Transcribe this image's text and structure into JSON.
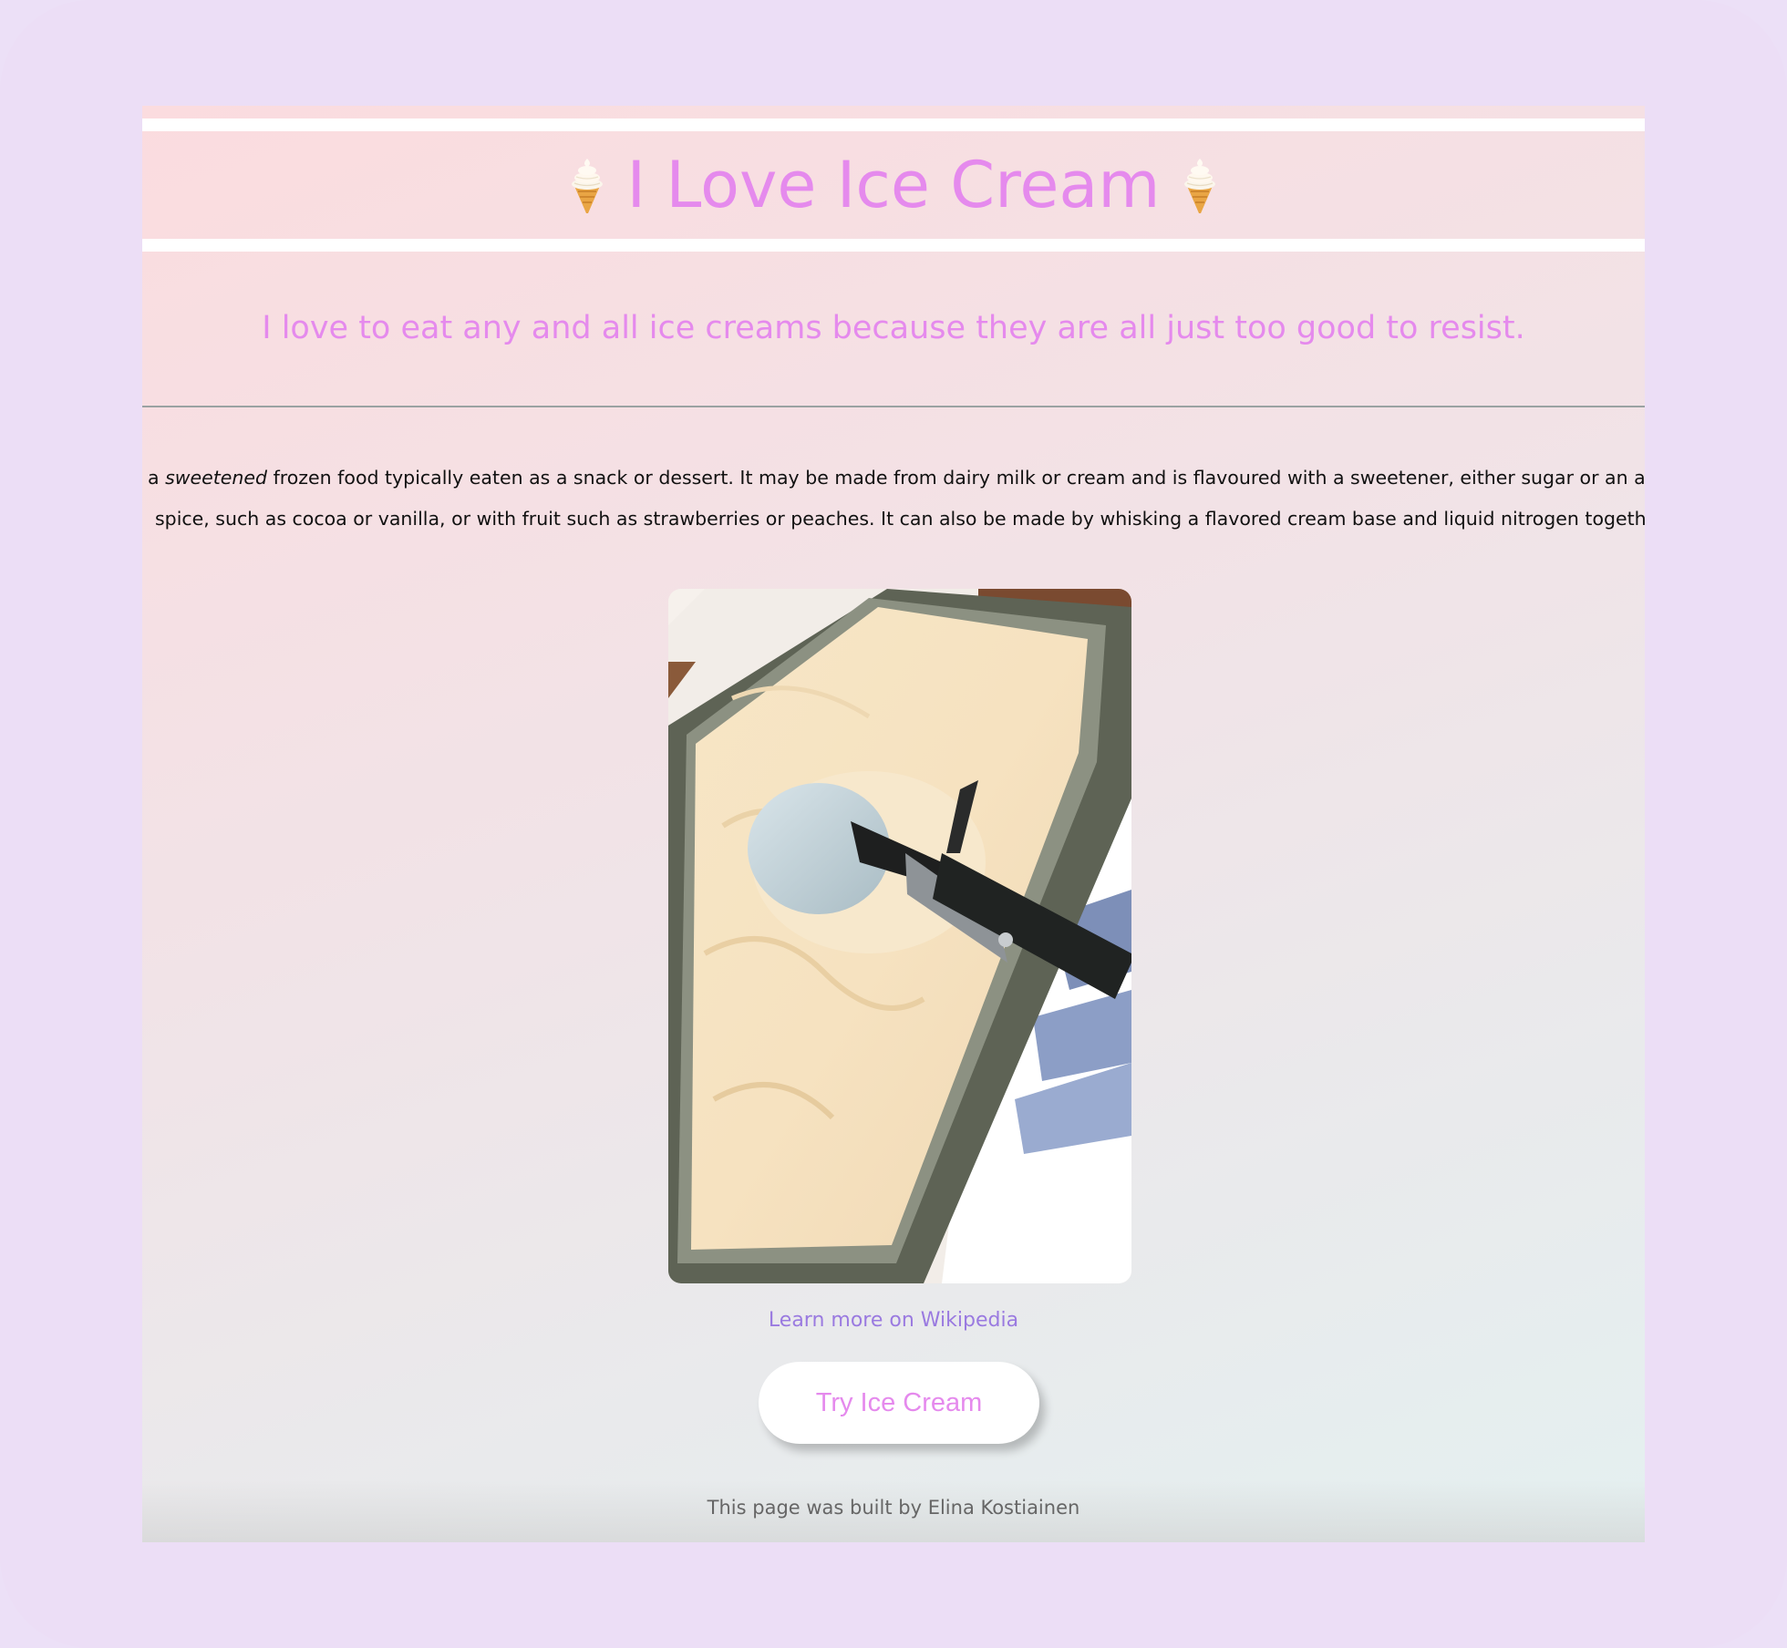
{
  "header": {
    "title": "I Love Ice Cream",
    "left_emoji_icon": "soft-serve-icon",
    "right_emoji_icon": "soft-serve-icon"
  },
  "tagline": "I love to eat any and all ice creams because they are all just too good to resist.",
  "description": {
    "line1_pre": "a ",
    "line1_em": "sweetened",
    "line1_post": " frozen food typically eaten as a snack or dessert. It may be made from dairy milk or cream and is flavoured with a sweetener, either sugar or an alter",
    "line2": "spice, such as cocoa or vanilla, or with fruit such as strawberries or peaches. It can also be made by whisking a flavored cream base and liquid nitrogen together."
  },
  "link": {
    "label": "Learn more on Wikipedia"
  },
  "button": {
    "label": "Try Ice Cream"
  },
  "footer": {
    "text": "This page was built by Elina Kostiainen"
  },
  "colors": {
    "accent": "#e58aed",
    "link": "#9a7ae0",
    "frame": "#ecdef6"
  }
}
